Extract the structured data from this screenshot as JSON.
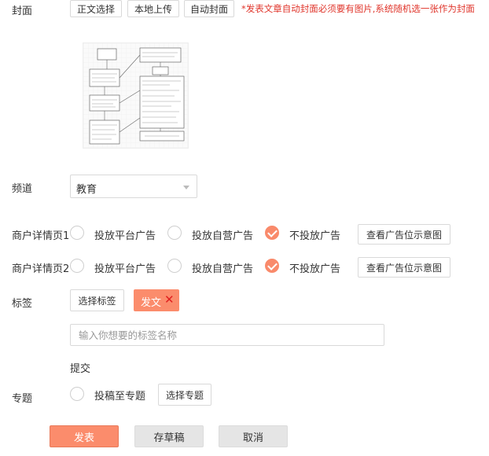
{
  "cover": {
    "label": "封面",
    "buttons": [
      "正文选择",
      "本地上传",
      "自动封面"
    ],
    "hint": "*发表文章自动封面必须要有图片,系统随机选一张作为封面"
  },
  "channel": {
    "label": "频道",
    "selected": "教育"
  },
  "merchant_rows": [
    {
      "label": "商户详情页1",
      "options": [
        "投放平台广告",
        "投放自营广告",
        "不投放广告"
      ],
      "selected_index": 2,
      "view_button": "查看广告位示意图"
    },
    {
      "label": "商户详情页2",
      "options": [
        "投放平台广告",
        "投放自营广告",
        "不投放广告"
      ],
      "selected_index": 2,
      "view_button": "查看广告位示意图"
    }
  ],
  "tags": {
    "label": "标签",
    "select_button": "选择标签",
    "chip_label": "发文",
    "chip_remove": "✕",
    "input_placeholder": "输入你想要的标签名称",
    "submit_label": "提交"
  },
  "topic": {
    "label": "专题",
    "option": "投稿至专题",
    "select_button": "选择专题"
  },
  "footer": {
    "publish": "发表",
    "draft": "存草稿",
    "cancel": "取消"
  },
  "colors": {
    "accent": "#fb8c6c",
    "hint_red": "#e0362c",
    "remove_x": "#e02020"
  }
}
